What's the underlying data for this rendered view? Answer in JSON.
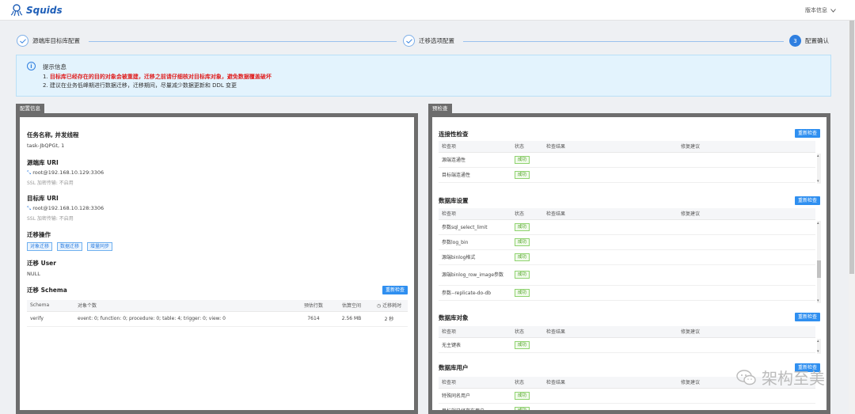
{
  "app": {
    "name": "Squids",
    "version_menu": "版本信息"
  },
  "steps": [
    {
      "label": "源端库目标库配置"
    },
    {
      "label": "迁移选项配置"
    },
    {
      "number": "3",
      "label": "配置确认"
    }
  ],
  "notice": {
    "title": "提示信息",
    "line1_prefix": "1. ",
    "line1_red": "目标库已经存在的目的对象会被重建，迁移之前请仔细核对目标库对象，避免数据覆盖破坏",
    "line2": "2. 建议在业务低峰期进行数据迁移，迁移期间，尽量减少数据更新和 DDL 变更"
  },
  "config": {
    "tab": "配置信息",
    "task_title": "任务名称, 并发线程",
    "task_value": "task-JbQPGt, 1",
    "src_title": "源端库 URI",
    "src_value": "root@192.168.10.129:3306",
    "src_ssl": "SSL 加密传输: 不启用",
    "dst_title": "目标库 URI",
    "dst_value": "root@192.168.10.128:3306",
    "dst_ssl": "SSL 加密传输: 不启用",
    "ops_title": "迁移操作",
    "ops": [
      "对象迁移",
      "数据迁移",
      "增量同步"
    ],
    "user_title": "迁移 User",
    "user_value": "NULL",
    "schema_title": "迁移 Schema",
    "recheck": "重新检查",
    "schema_headers": [
      "Schema",
      "对象个数",
      "预估行数",
      "估算空间",
      "迁移耗时"
    ],
    "schema_rows": [
      [
        "verify",
        "event: 0; function: 0; procedure: 0; table: 4; trigger: 0; view: 0",
        "7614",
        "2.56 MB",
        "2 秒"
      ]
    ]
  },
  "precheck": {
    "tab": "预检查",
    "recheck": "重新检查",
    "headers": [
      "检查项",
      "状态",
      "检查结果",
      "修复建议"
    ],
    "sections": [
      {
        "title": "连接性检查",
        "rows": [
          [
            "源端连通性",
            "成功"
          ],
          [
            "目标端连通性",
            "成功"
          ]
        ]
      },
      {
        "title": "数据库设置",
        "rows": [
          [
            "参数sql_select_limit",
            "成功"
          ],
          [
            "参数log_bin",
            "成功"
          ],
          [
            "源端binlog格式",
            "成功"
          ],
          [
            "源端binlog_row_image参数",
            "成功"
          ],
          [
            "参数--replicate-do-db",
            "成功"
          ]
        ]
      },
      {
        "title": "数据库对象",
        "rows": [
          [
            "无主键表",
            "成功"
          ]
        ]
      },
      {
        "title": "数据库用户",
        "rows": [
          [
            "特殊同名用户",
            "成功"
          ],
          [
            "目标端已经存在用户",
            "成功"
          ]
        ]
      }
    ]
  },
  "watermark": "架构至美",
  "colors": {
    "brand": "#1f5fb8",
    "accent": "#2f8ff0",
    "success": "#4aa020",
    "danger": "#e02020"
  }
}
